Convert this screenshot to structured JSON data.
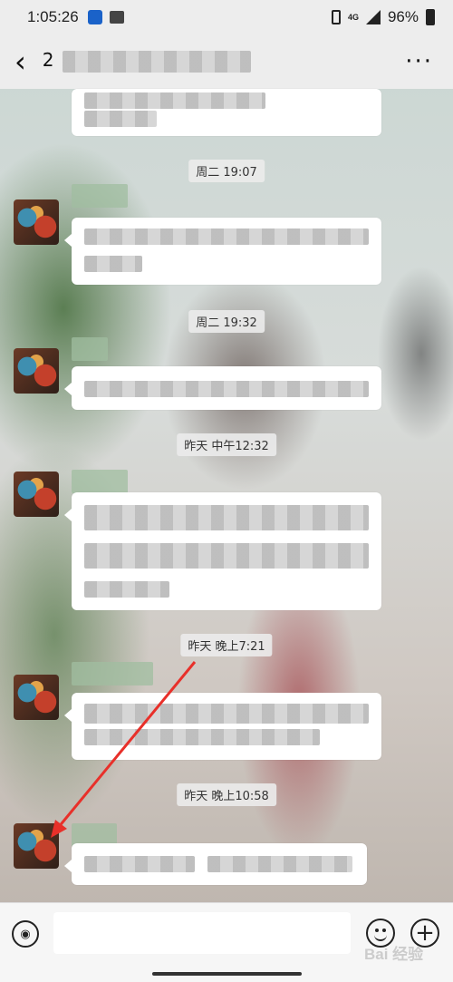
{
  "status_bar": {
    "time": "1:05:26",
    "network": "4G",
    "battery": "96%",
    "icons": [
      "app-icon",
      "gallery-icon",
      "vibrate-icon",
      "signal-icon",
      "battery-icon"
    ]
  },
  "header": {
    "title": "2",
    "back_icon": "back-arrow-icon",
    "more_icon": "more-dots-icon",
    "more_label": "···"
  },
  "timestamps": [
    "周二 19:07",
    "周二 19:32",
    "昨天 中午12:32",
    "昨天 晚上7:21",
    "昨天 晚上10:58"
  ],
  "input_bar": {
    "voice_icon": "voice-icon",
    "emoji_icon": "emoji-icon",
    "plus_icon": "plus-icon",
    "plus_label": "+",
    "input_value": ""
  },
  "watermark": "Bai 经验",
  "colors": {
    "bar_background": "#ededed",
    "bubble": "#ffffff",
    "arrow": "#e8302a"
  }
}
